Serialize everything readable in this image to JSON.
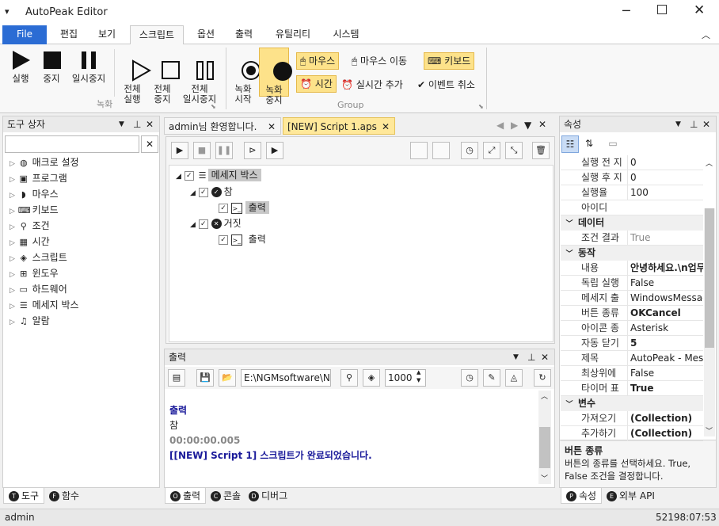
{
  "app": {
    "title": "AutoPeak Editor"
  },
  "menu": {
    "file": "File",
    "tabs": [
      "편집",
      "보기",
      "스크립트",
      "옵션",
      "출력",
      "유틸리티",
      "시스템"
    ]
  },
  "ribbon": {
    "run": "실행",
    "stop": "중지",
    "pause": "일시중지",
    "run_all": "전체\n실행",
    "stop_all": "전체\n중지",
    "pause_all": "전체\n일시중지",
    "rec_start": "녹화\n시작",
    "rec_stop": "녹화\n중지",
    "group_record": "녹화",
    "group_group": "Group",
    "mouse": "마우스",
    "mouse_move": "마우스 이동",
    "keyboard": "키보드",
    "time": "시간",
    "realtime_add": "실시간 추가",
    "event_cancel": "이벤트 취소"
  },
  "toolbox": {
    "title": "도구 상자",
    "items": [
      "매크로 설정",
      "프로그램",
      "마우스",
      "키보드",
      "조건",
      "시간",
      "스크립트",
      "윈도우",
      "하드웨어",
      "메세지 박스",
      "알람"
    ]
  },
  "doc_tabs": [
    "admin님 환영합니다.",
    "[NEW] Script 1.aps"
  ],
  "script_tree": {
    "root": "메세지 박스",
    "true_label": "참",
    "true_child": "출력",
    "false_label": "거짓",
    "false_child": "출력"
  },
  "output": {
    "title": "출력",
    "path": "E:\\NGMsoftware\\NG",
    "count": "1000",
    "lines": [
      {
        "text": "출력",
        "color": "#1a1a9a"
      },
      {
        "text": "참",
        "color": "#222"
      },
      {
        "text": "00:00:00.005",
        "color": "#888"
      },
      {
        "text": "[[NEW] Script 1] 스크립트가 완료되었습니다.",
        "color": "#1a1a9a"
      }
    ]
  },
  "properties": {
    "title": "속성",
    "rows_top": [
      [
        "실행 전 지",
        "0"
      ],
      [
        "실행 후 지",
        "0"
      ],
      [
        "실행율",
        "100"
      ],
      [
        "아이디",
        ""
      ]
    ],
    "cat_data": "데이터",
    "data_rows": [
      [
        "조건 결과",
        "True"
      ]
    ],
    "cat_action": "동작",
    "action_rows": [
      [
        "내용",
        "안녕하세요.\\n업무"
      ],
      [
        "독립 실행",
        "False"
      ],
      [
        "메세지 출",
        "WindowsMessage"
      ],
      [
        "버튼 종류",
        "OKCancel"
      ],
      [
        "아이콘 종",
        "Asterisk"
      ],
      [
        "자동 닫기",
        "5"
      ],
      [
        "제목",
        "AutoPeak - Messa"
      ],
      [
        "최상위에",
        "False"
      ],
      [
        "타이머 표",
        "True"
      ]
    ],
    "cat_var": "변수",
    "var_rows": [
      [
        "가져오기",
        "(Collection)"
      ],
      [
        "추가하기",
        "(Collection)"
      ]
    ],
    "desc_title": "버튼 종류",
    "desc_text": "버튼의 종류를 선택하세요. True, False 조건을 결정합니다."
  },
  "bottom_tabs": {
    "left": [
      "도구",
      "함수"
    ],
    "mid": [
      "출력",
      "콘솔",
      "디버그"
    ],
    "right": [
      "속성",
      "외부 API"
    ]
  },
  "status": {
    "user": "admin",
    "time": "52198:07:53"
  }
}
